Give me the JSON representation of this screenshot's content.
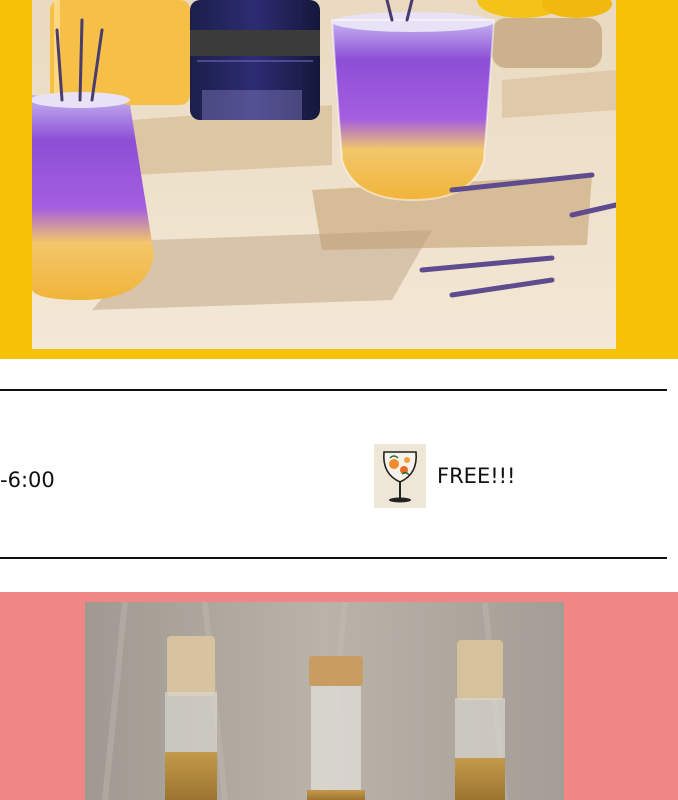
{
  "hours_section": {
    "hours_text": "-6:00"
  },
  "promo": {
    "icon": "wine-glass-flowers-icon",
    "text": "FREE!!!"
  },
  "colors": {
    "hero_bg": "#f6c107",
    "bottom_bg": "#f08686",
    "rule": "#111111"
  }
}
